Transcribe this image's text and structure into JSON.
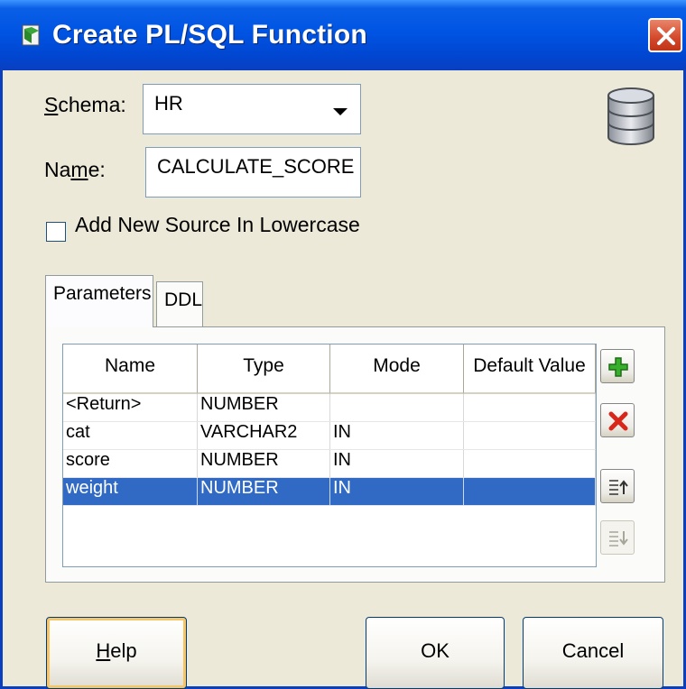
{
  "window": {
    "title": "Create PL/SQL Function",
    "icon": "plsql-function-icon",
    "close_icon": "close-icon"
  },
  "form": {
    "schema_label_prefix": "S",
    "schema_label_rest": "chema:",
    "schema_value": "HR",
    "name_label_prefix": "Na",
    "name_label_mnemonic": "m",
    "name_label_rest": "e:",
    "name_value": "CALCULATE_SCORE",
    "lowercase_label": "Add New Source In Lowercase",
    "lowercase_checked": false
  },
  "tabs": [
    {
      "label": "Parameters",
      "active": true
    },
    {
      "label": "DDL",
      "active": false
    }
  ],
  "grid": {
    "columns": [
      "Name",
      "Type",
      "Mode",
      "Default Value"
    ],
    "rows": [
      {
        "name": "<Return>",
        "type": "NUMBER",
        "mode": "",
        "default": "",
        "selected": false
      },
      {
        "name": "cat",
        "type": "VARCHAR2",
        "mode": "IN",
        "default": "",
        "selected": false
      },
      {
        "name": "score",
        "type": "NUMBER",
        "mode": "IN",
        "default": "",
        "selected": false
      },
      {
        "name": "weight",
        "type": "NUMBER",
        "mode": "IN",
        "default": "",
        "selected": true
      }
    ]
  },
  "side_buttons": [
    {
      "icon": "add-icon",
      "enabled": true
    },
    {
      "icon": "delete-icon",
      "enabled": true
    },
    {
      "icon": "move-up-icon",
      "enabled": true
    },
    {
      "icon": "move-down-icon",
      "enabled": false
    }
  ],
  "buttons": {
    "help_mnemonic": "H",
    "help_rest": "elp",
    "ok": "OK",
    "cancel": "Cancel"
  },
  "colors": {
    "titlebar": "#0054e3",
    "selection": "#316ac5",
    "dialog_bg": "#ece9d8"
  }
}
